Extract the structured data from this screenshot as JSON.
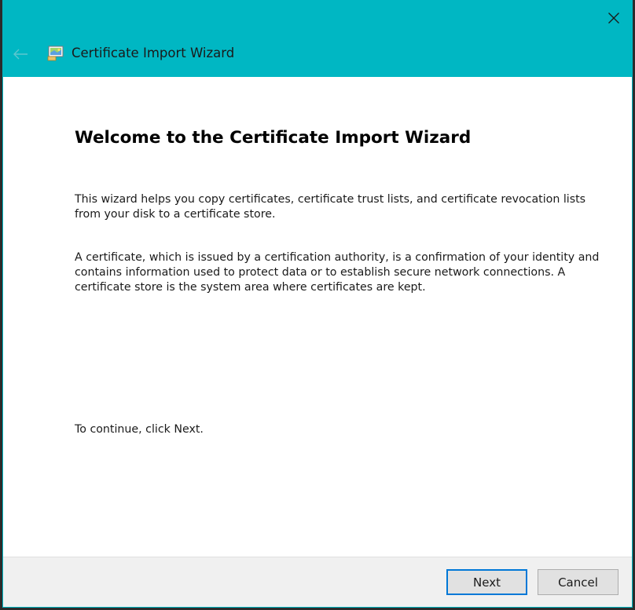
{
  "window": {
    "title": "Certificate Import Wizard",
    "accent_color": "#00b7c3",
    "icons": {
      "close": "close-icon",
      "back": "back-arrow-icon",
      "app": "certificate-icon"
    }
  },
  "main": {
    "heading": "Welcome to the Certificate Import Wizard",
    "paragraph1": "This wizard helps you copy certificates, certificate trust lists, and certificate revocation lists from your disk to a certificate store.",
    "paragraph2": "A certificate, which is issued by a certification authority, is a confirmation of your identity and contains information used to protect data or to establish secure network connections. A certificate store is the system area where certificates are kept.",
    "continue_text": "To continue, click Next."
  },
  "footer": {
    "next_label": "Next",
    "cancel_label": "Cancel"
  }
}
